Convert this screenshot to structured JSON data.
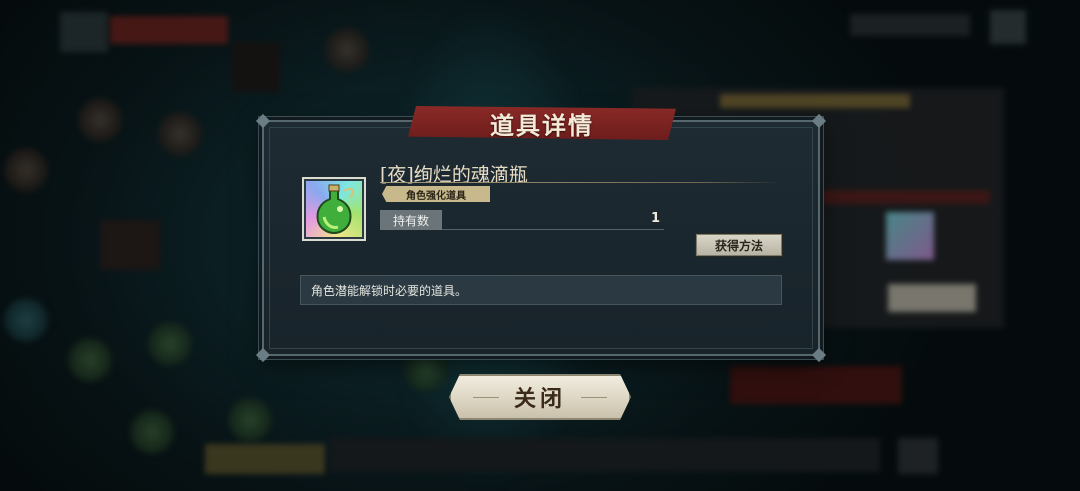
{
  "dialog": {
    "title": "道具详情",
    "item": {
      "name": "[夜]绚烂的魂滴瓶",
      "type_tag": "角色强化道具",
      "owned_label": "持有数",
      "owned_count": "1",
      "acquire_button": "获得方法",
      "description": "角色潜能解锁时必要的道具。",
      "icon": "green-potion-bottle-icon"
    },
    "close_button": "关闭"
  },
  "colors": {
    "banner_red": "#7a2321",
    "panel_bg": "#1c2930",
    "tag_gold": "#c7b98b",
    "button_cream": "#e8e2d2"
  }
}
